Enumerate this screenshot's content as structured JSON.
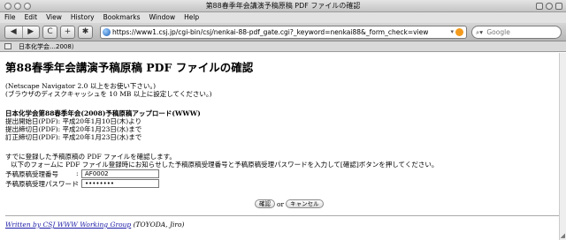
{
  "window": {
    "title": "第88春季年会講演予稿原稿 PDF ファイルの確認"
  },
  "menu": [
    "File",
    "Edit",
    "View",
    "History",
    "Bookmarks",
    "Window",
    "Help"
  ],
  "toolbar": {
    "back": "◀",
    "forward": "▶",
    "reload": "C",
    "add": "+",
    "settings": "✱",
    "url": "https://www1.csj.jp/cgi-bin/csj/nenkai-88-pdf_gate.cgi?_keyword=nenkai88&_form_check=view",
    "search_placeholder": "Google"
  },
  "bookmarks": {
    "item": "日本化学会…2008）"
  },
  "page": {
    "heading": "第88春季年会講演予稿原稿 PDF ファイルの確認",
    "note1": "(Netscape Navigator 2.0 以上をお使い下さい。)",
    "note2": "(ブラウザのディスクキャッシュを 10 MB 以上に設定してください。)",
    "upload_title": "日本化学会第88春季年会(2008)予稿原稿アップロード(WWW)",
    "submit_start": "提出開始日(PDF): 平成20年1月10日(木)より",
    "submit_end": "提出締切日(PDF): 平成20年1月23日(水)まで",
    "correction_end": "訂正締切日(PDF): 平成20年1月23日(水)まで",
    "confirm1": "すでに登録した予稿原稿の PDF ファイルを確認します。",
    "confirm2": "以下のフォームに PDF ファイル登録時にお知らせした予稿原稿受理番号と予稿原稿受理パスワードを入力して[確認]ボタンを押してください。",
    "label_number": "予稿原稿受理番号",
    "label_password": "予稿原稿受理パスワード",
    "colon": ":",
    "value_number": "AF0002",
    "value_password": "••••••••",
    "btn_confirm": "確認",
    "or": "or",
    "btn_cancel": "キャンセル",
    "footer_link": "Written by CSJ WWW Working Group",
    "footer_author": "(TOYODA, Jiro)"
  }
}
